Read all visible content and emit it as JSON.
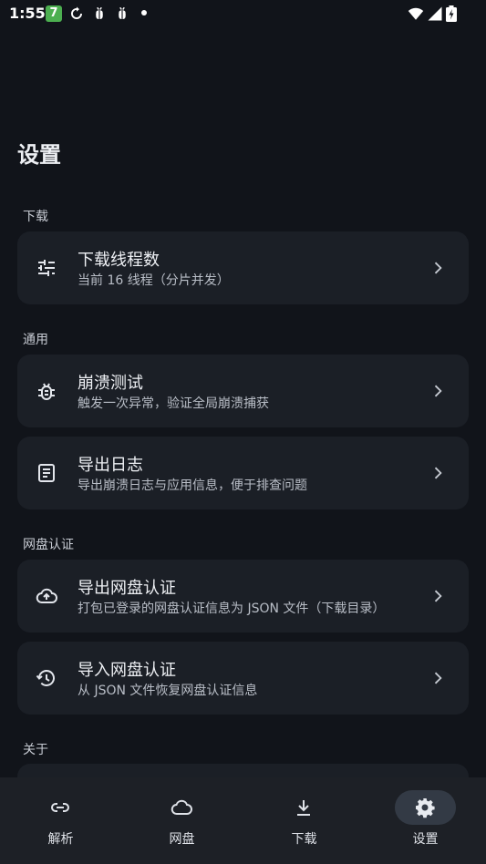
{
  "status_bar": {
    "time": "1:55",
    "badge": "7",
    "icons": [
      "sync-icon",
      "bug-icon",
      "bug-icon",
      "dot",
      "wifi-icon",
      "signal-icon",
      "battery-icon"
    ]
  },
  "page": {
    "title": "设置"
  },
  "sections": {
    "download": {
      "label": "下载",
      "items": [
        {
          "icon": "tune-icon",
          "title": "下载线程数",
          "subtitle": "当前 16 线程（分片并发）"
        }
      ]
    },
    "general": {
      "label": "通用",
      "items": [
        {
          "icon": "bug-icon",
          "title": "崩溃测试",
          "subtitle": "触发一次异常，验证全局崩溃捕获"
        },
        {
          "icon": "document-icon",
          "title": "导出日志",
          "subtitle": "导出崩溃日志与应用信息，便于排查问题"
        }
      ]
    },
    "cloud_auth": {
      "label": "网盘认证",
      "items": [
        {
          "icon": "cloud-upload-icon",
          "title": "导出网盘认证",
          "subtitle": "打包已登录的网盘认证信息为 JSON 文件（下载目录）"
        },
        {
          "icon": "restore-icon",
          "title": "导入网盘认证",
          "subtitle": "从 JSON 文件恢复网盘认证信息"
        }
      ]
    },
    "about": {
      "label": "关于"
    }
  },
  "bottom_nav": {
    "items": [
      {
        "icon": "link-icon",
        "label": "解析",
        "active": false
      },
      {
        "icon": "cloud-icon",
        "label": "网盘",
        "active": false
      },
      {
        "icon": "download-icon",
        "label": "下载",
        "active": false
      },
      {
        "icon": "gear-icon",
        "label": "设置",
        "active": true
      }
    ]
  },
  "colors": {
    "background": "#11141a",
    "card": "#1b1f26",
    "nav_background": "#1d2026",
    "nav_active_pill": "#333a45"
  }
}
